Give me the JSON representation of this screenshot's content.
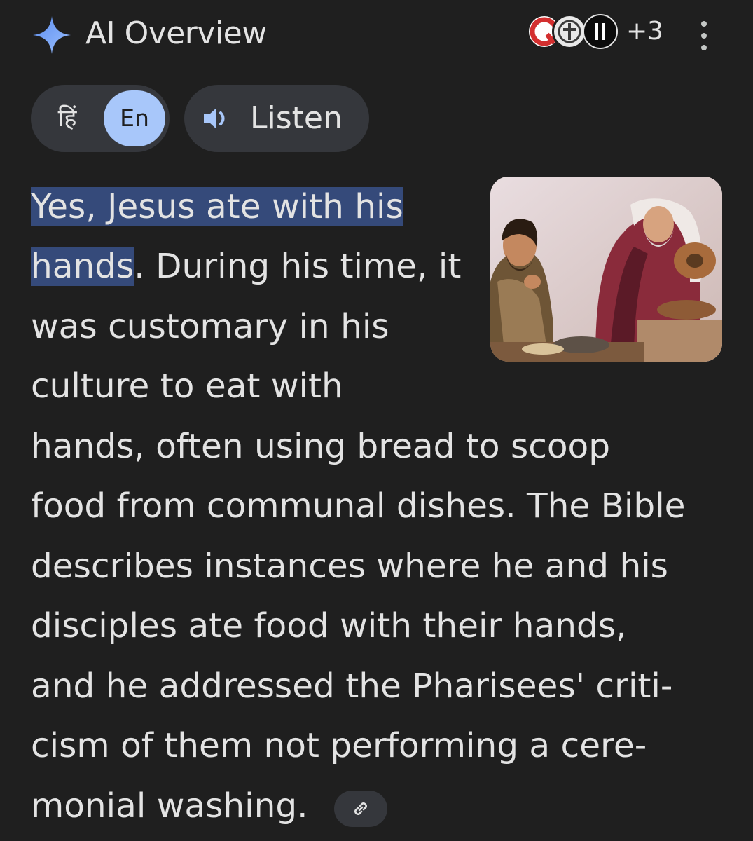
{
  "header": {
    "title": "AI Overview",
    "icon": "gemini-sparkle-icon",
    "accent_color": "#8ab4f8",
    "sources_more": "+3",
    "menu_icon": "more-vert-icon"
  },
  "controls": {
    "hindi_label": "हिं",
    "english_label": "En",
    "english_selected": true,
    "listen_label": "Listen",
    "listen_icon": "speaker-icon",
    "selected_color": "#a8c7fa"
  },
  "answer": {
    "lines": [
      {
        "highlight": "Yes, Jesus ate with his",
        "text": ""
      },
      {
        "highlight": "hands",
        "text": ". During his time, it"
      },
      {
        "highlight": "",
        "text": "was customary in his"
      },
      {
        "highlight": "",
        "text": "culture to eat with"
      },
      {
        "highlight": "",
        "text": "hands, often using bread to scoop"
      },
      {
        "highlight": "",
        "text": "food from communal dishes. The Bible"
      },
      {
        "highlight": "",
        "text": "describes instances where he and his"
      },
      {
        "highlight": "",
        "text": "disciples ate food with their hands,"
      },
      {
        "highlight": "",
        "text": "and he addressed the Pharisees' criti-"
      },
      {
        "highlight": "",
        "text": "cism of them not performing a cere-"
      },
      {
        "highlight": "",
        "text": "monial washing."
      }
    ],
    "highlight_color": "#354a7a",
    "link_icon": "link-icon"
  },
  "image": {
    "subject": "illustration-jesus-eating-while-pharisee-washes-hands"
  }
}
